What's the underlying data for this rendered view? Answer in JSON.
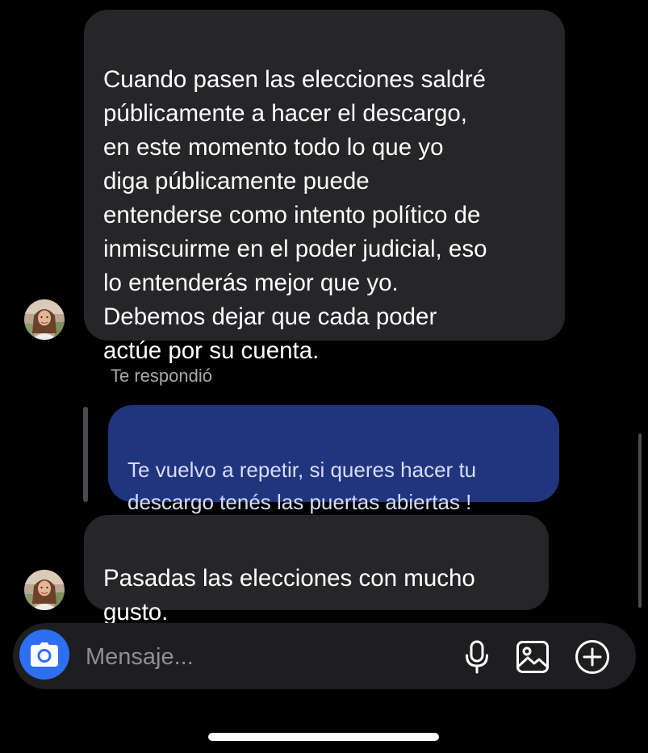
{
  "conversation": {
    "messages": [
      {
        "sender": "other",
        "text": "Cuando pasen las elecciones saldré\npúblicamente a hacer el descargo,\nen este momento todo lo que yo\ndiga públicamente puede\nentenderse como intento político de\ninmiscuirme en el poder judicial, eso\nlo entenderás mejor que yo.\nDebemos dejar que cada poder\nactúe por su cuenta."
      },
      {
        "sender": "other",
        "reply_label": "Te respondió",
        "quoted_text": "Te vuelvo a repetir, si queres hacer tu\ndescargo tenés las puertas abiertas !",
        "text": "Pasadas las elecciones con mucho\ngusto."
      }
    ]
  },
  "composer": {
    "placeholder": "Mensaje...",
    "value": "",
    "icons": {
      "camera": "camera-icon",
      "microphone": "microphone-icon",
      "gallery": "gallery-icon",
      "add": "add-circle-icon"
    }
  },
  "colors": {
    "background": "#000000",
    "incoming_bubble": "#262628",
    "quoted_bubble": "#21357f",
    "camera_button": "#2e6ff2"
  }
}
